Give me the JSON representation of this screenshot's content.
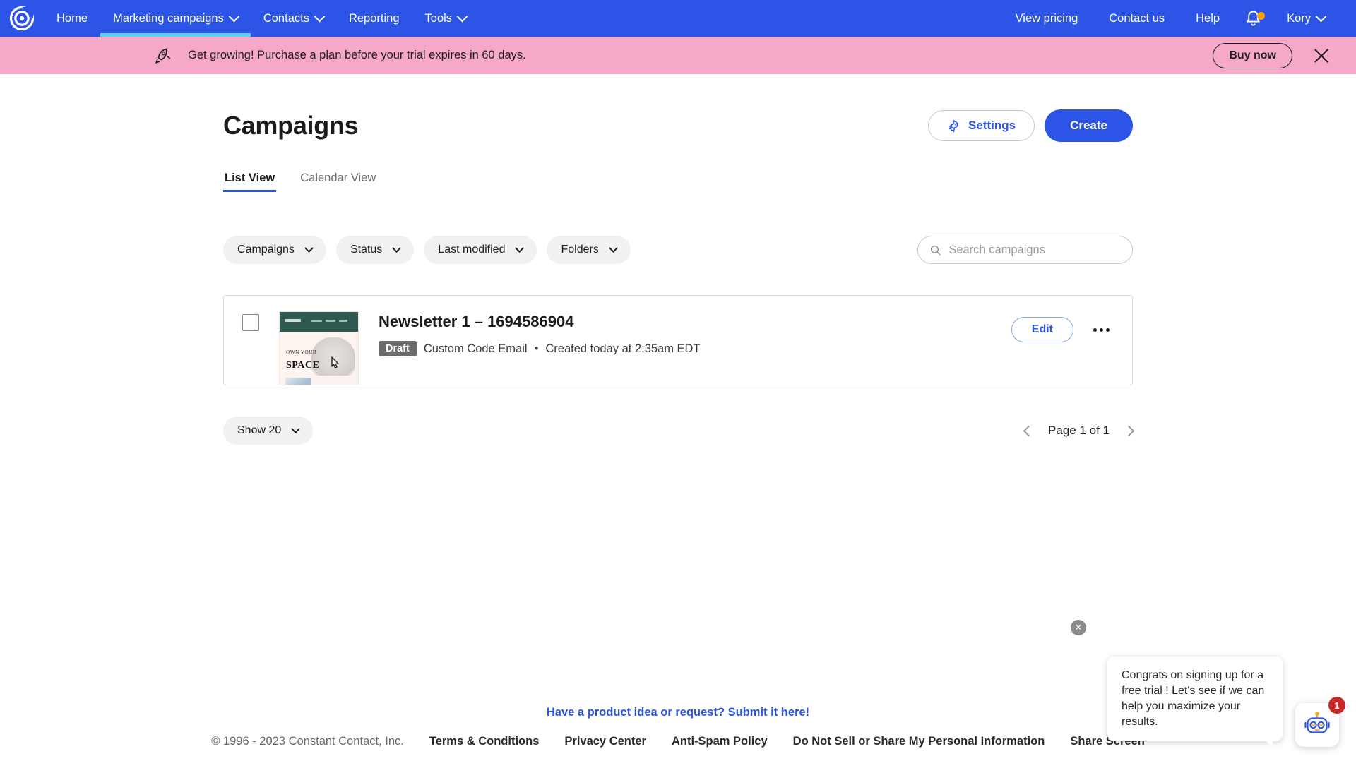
{
  "topnav": {
    "logo": "constant-contact-logo",
    "left_items": [
      {
        "label": "Home",
        "has_caret": false,
        "active": false
      },
      {
        "label": "Marketing campaigns",
        "has_caret": true,
        "active": true
      },
      {
        "label": "Contacts",
        "has_caret": true,
        "active": false
      },
      {
        "label": "Reporting",
        "has_caret": false,
        "active": false
      },
      {
        "label": "Tools",
        "has_caret": true,
        "active": false
      }
    ],
    "right_items": [
      {
        "label": "View pricing"
      },
      {
        "label": "Contact us"
      },
      {
        "label": "Help"
      }
    ],
    "bell_icon": "notification-bell-icon",
    "account_label": "Kory",
    "bg_color": "#2c55e8",
    "active_underline_color": "#5ed0f7"
  },
  "banner": {
    "icon": "rocket-icon",
    "message": "Get growing! Purchase a plan before your trial expires in 60 days.",
    "buy_label": "Buy now",
    "close_icon": "close-icon",
    "bg_color": "#f5a8c8"
  },
  "header": {
    "title": "Campaigns",
    "settings_label": "Settings",
    "settings_icon": "gear-icon",
    "create_label": "Create"
  },
  "tabs": [
    {
      "label": "List View",
      "active": true
    },
    {
      "label": "Calendar View",
      "active": false
    }
  ],
  "filters": [
    {
      "label": "Campaigns"
    },
    {
      "label": "Status"
    },
    {
      "label": "Last modified"
    },
    {
      "label": "Folders"
    }
  ],
  "search": {
    "icon": "search-icon",
    "placeholder": "Search campaigns",
    "value": ""
  },
  "campaigns": [
    {
      "title": "Newsletter 1 – 1694586904",
      "status": "Draft",
      "type": "Custom Code Email",
      "separator": "•",
      "created": "Created today at 2:35am EDT",
      "edit_label": "Edit",
      "more_icon": "kebab-menu-icon",
      "checkbox_checked": false,
      "thumbnail": {
        "headline_top": "OWN YOUR",
        "headline_bottom": "SPACE",
        "header_bg": "#2e5950"
      }
    }
  ],
  "pagination": {
    "show_label": "Show 20",
    "page_label": "Page 1 of 1",
    "prev_icon": "chevron-left-icon",
    "next_icon": "chevron-right-icon"
  },
  "footer": {
    "cta": "Have a product idea or request? Submit it here!",
    "copyright": "© 1996 - 2023 Constant Contact, Inc.",
    "links": [
      "Terms & Conditions",
      "Privacy Center",
      "Anti-Spam Policy",
      "Do Not Sell or Share My Personal Information",
      "Share Screen"
    ]
  },
  "chat": {
    "close_icon": "close-icon",
    "message": "Congrats on signing up for a free trial ! Let's see if we can help you maximize your results.",
    "bot_icon": "chat-bot-icon",
    "badge_count": "1",
    "badge_color": "#c62828"
  }
}
